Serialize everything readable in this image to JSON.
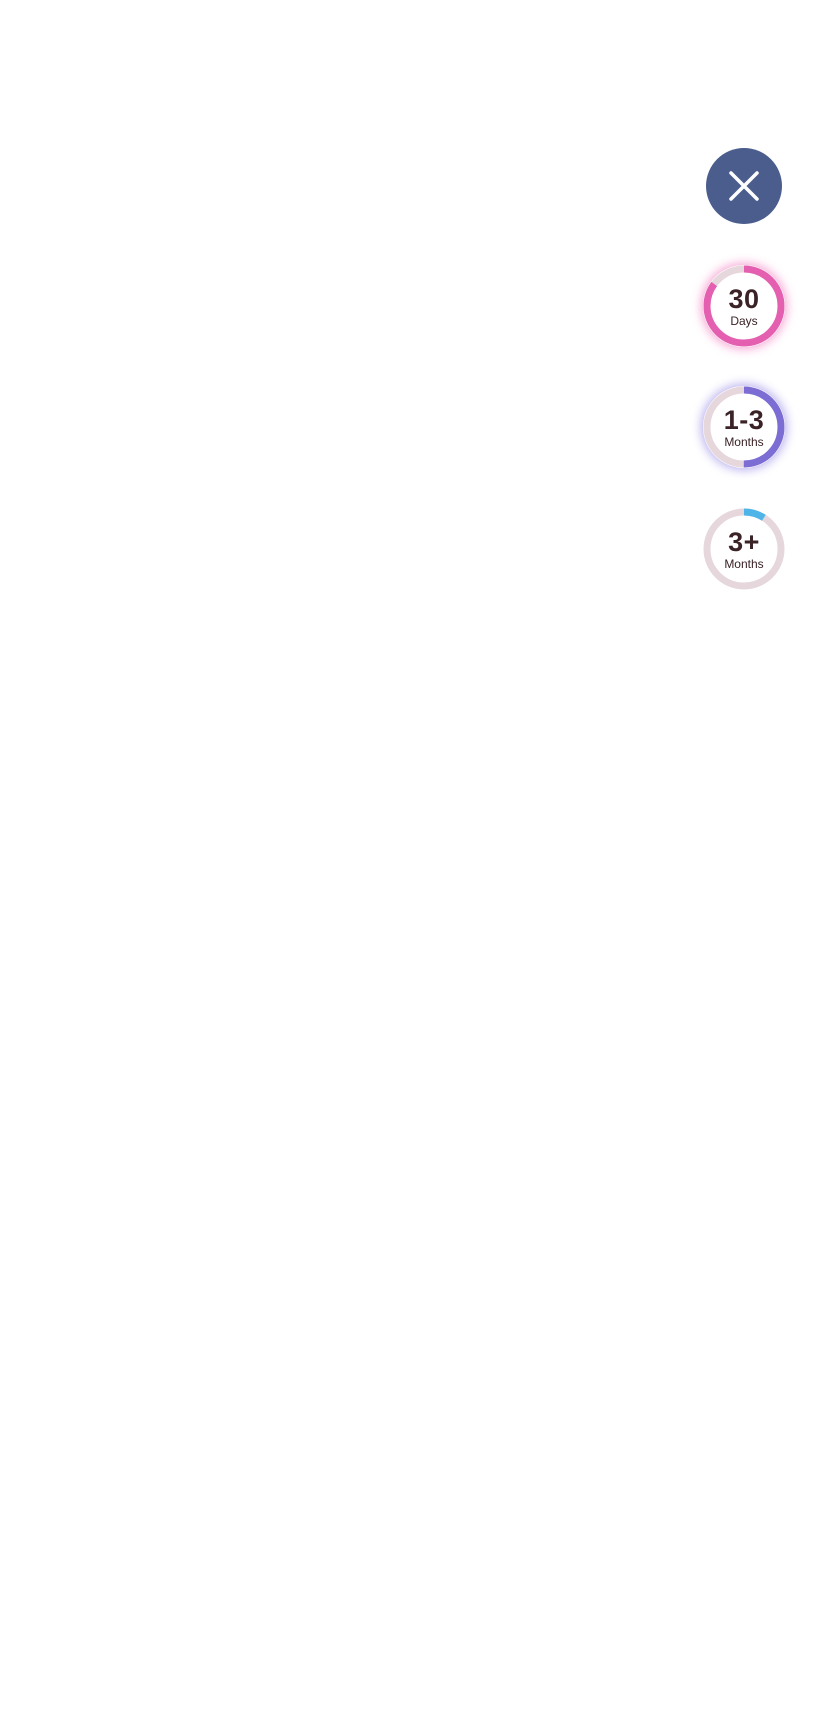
{
  "close_button": {
    "icon": "close-icon",
    "color": "#4a5d8c"
  },
  "filters": [
    {
      "value": "30",
      "unit": "Days",
      "progress": 0.85,
      "color": "#e45fb0",
      "glow": "#f6a6d4"
    },
    {
      "value": "1-3",
      "unit": "Months",
      "progress": 0.5,
      "color": "#7b6dd3",
      "glow": "#b8b0ee"
    },
    {
      "value": "3+",
      "unit": "Months",
      "progress": 0.09,
      "color": "#4fb4e8",
      "glow": "none"
    }
  ],
  "track_color": "#e6d7dc"
}
